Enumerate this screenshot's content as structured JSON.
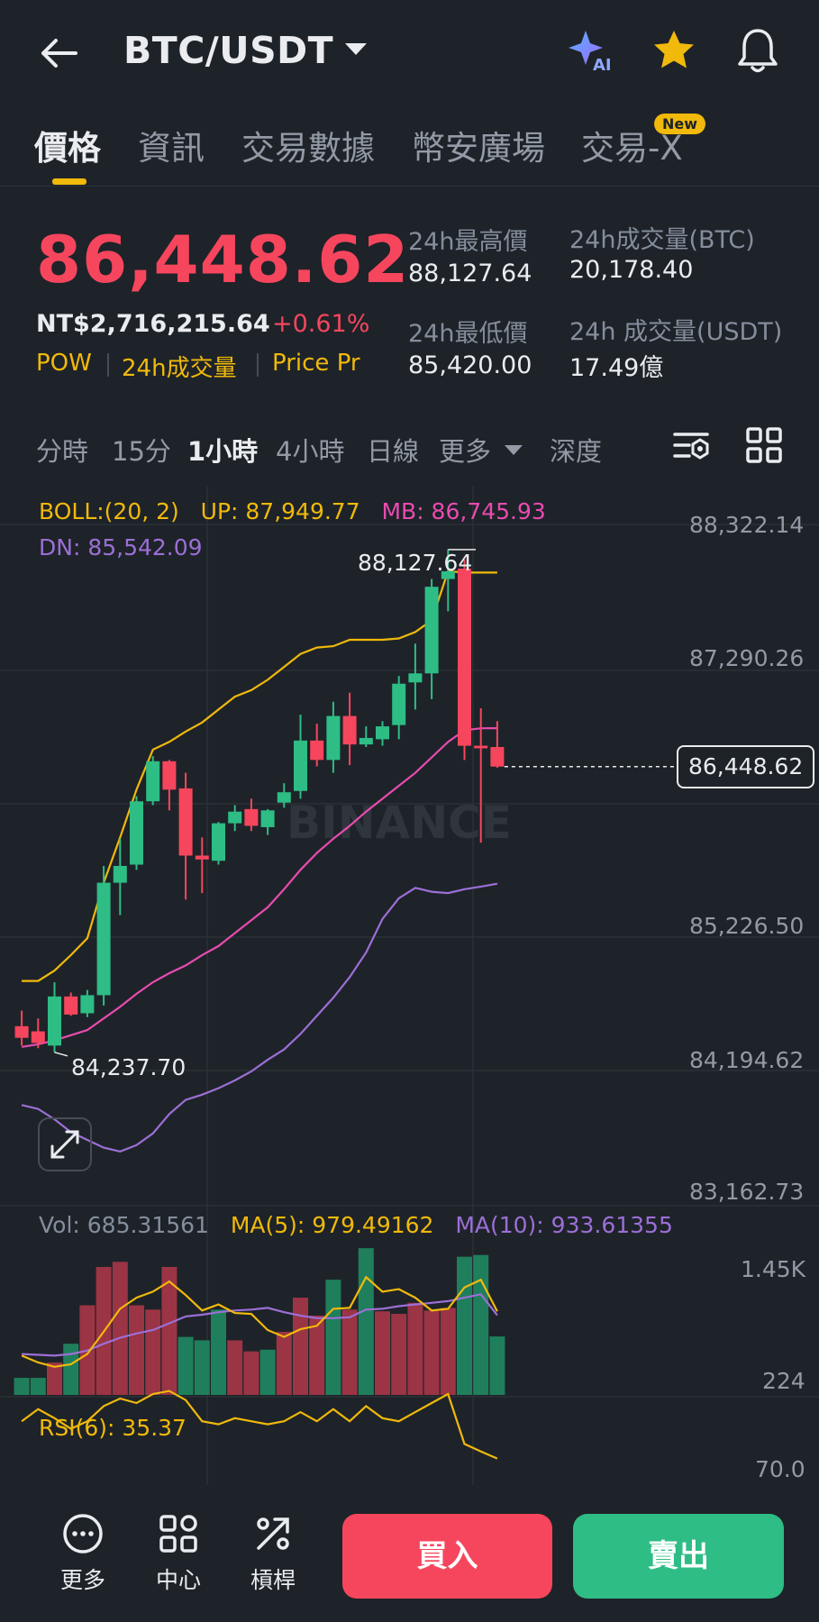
{
  "header": {
    "pair": "BTC/USDT"
  },
  "tabs": [
    {
      "label": "價格",
      "active": true
    },
    {
      "label": "資訊"
    },
    {
      "label": "交易數據"
    },
    {
      "label": "幣安廣場"
    },
    {
      "label": "交易-X",
      "badge": "New"
    }
  ],
  "ticker": {
    "last_price": "86,448.62",
    "fiat_price": "NT$2,716,215.64",
    "change_pct": "+0.61%",
    "tags": [
      "POW",
      "24h成交量",
      "Price Pr"
    ],
    "stats": [
      {
        "label": "24h最高價",
        "value": "88,127.64"
      },
      {
        "label": "24h成交量(BTC)",
        "value": "20,178.40"
      },
      {
        "label": "24h最低價",
        "value": "85,420.00"
      },
      {
        "label": "24h 成交量(USDT)",
        "value": "17.49億"
      }
    ]
  },
  "intervals": [
    "分時",
    "15分",
    "1小時",
    "4小時",
    "日線",
    "更多",
    "深度"
  ],
  "active_interval": "1小時",
  "indicators": {
    "boll_name": "BOLL:(20, 2)",
    "boll_up": "UP: 87,949.77",
    "boll_mb": "MB: 86,745.93",
    "boll_dn": "DN: 85,542.09",
    "vol": "Vol: 685.31561",
    "vol_ma5": "MA(5): 979.49162",
    "vol_ma10": "MA(10): 933.61355",
    "rsi": "RSI(6): 35.37"
  },
  "chart_axes": {
    "price_ticks": [
      "88,322.14",
      "87,290.26",
      "85,226.50",
      "84,194.62",
      "83,162.73"
    ],
    "current_price": "86,448.62",
    "high_marker": "88,127.64",
    "low_marker": "84,237.70",
    "vol_ticks": [
      "1.45K",
      "224"
    ],
    "rsi_ticks": [
      "70.0"
    ]
  },
  "watermark": "BINANCE",
  "colors": {
    "up": "#2ebd85",
    "down": "#f6465d",
    "accent": "#f0b90b",
    "mb": "#e84bb0",
    "dn": "#9c6fd6"
  },
  "chart_data": {
    "type": "candlestick",
    "candles": [
      {
        "o": 84440,
        "h": 84560,
        "l": 84290,
        "c": 84350
      },
      {
        "o": 84400,
        "h": 84500,
        "l": 84270,
        "c": 84310
      },
      {
        "o": 84290,
        "h": 84780,
        "l": 84237.7,
        "c": 84670
      },
      {
        "o": 84670,
        "h": 84700,
        "l": 84520,
        "c": 84530
      },
      {
        "o": 84540,
        "h": 84720,
        "l": 84510,
        "c": 84680
      },
      {
        "o": 84680,
        "h": 85680,
        "l": 84600,
        "c": 85550
      },
      {
        "o": 85550,
        "h": 85890,
        "l": 85300,
        "c": 85680
      },
      {
        "o": 85690,
        "h": 86220,
        "l": 85650,
        "c": 86180
      },
      {
        "o": 86180,
        "h": 86530,
        "l": 86150,
        "c": 86490
      },
      {
        "o": 86490,
        "h": 86500,
        "l": 86110,
        "c": 86270
      },
      {
        "o": 86280,
        "h": 86400,
        "l": 85420,
        "c": 85760
      },
      {
        "o": 85760,
        "h": 85900,
        "l": 85470,
        "c": 85730
      },
      {
        "o": 85720,
        "h": 86020,
        "l": 85690,
        "c": 86010
      },
      {
        "o": 86010,
        "h": 86150,
        "l": 85950,
        "c": 86100
      },
      {
        "o": 86120,
        "h": 86200,
        "l": 85950,
        "c": 85990
      },
      {
        "o": 85980,
        "h": 86120,
        "l": 85920,
        "c": 86110
      },
      {
        "o": 86170,
        "h": 86320,
        "l": 86130,
        "c": 86250
      },
      {
        "o": 86260,
        "h": 86850,
        "l": 86200,
        "c": 86650
      },
      {
        "o": 86650,
        "h": 86780,
        "l": 86450,
        "c": 86500
      },
      {
        "o": 86500,
        "h": 86950,
        "l": 86400,
        "c": 86840
      },
      {
        "o": 86840,
        "h": 87020,
        "l": 86460,
        "c": 86620
      },
      {
        "o": 86620,
        "h": 86760,
        "l": 86600,
        "c": 86670
      },
      {
        "o": 86660,
        "h": 86800,
        "l": 86610,
        "c": 86760
      },
      {
        "o": 86770,
        "h": 87150,
        "l": 86660,
        "c": 87090
      },
      {
        "o": 87100,
        "h": 87400,
        "l": 86890,
        "c": 87170
      },
      {
        "o": 87170,
        "h": 87900,
        "l": 86970,
        "c": 87840
      },
      {
        "o": 87900,
        "h": 88127.64,
        "l": 87650,
        "c": 87960
      },
      {
        "o": 87980,
        "h": 88050,
        "l": 86500,
        "c": 86610
      },
      {
        "o": 86610,
        "h": 86900,
        "l": 85860,
        "c": 86590
      },
      {
        "o": 86600,
        "h": 86800,
        "l": 86440,
        "c": 86448.62
      }
    ],
    "boll_up": [
      84790,
      84790,
      84870,
      84990,
      85120,
      85550,
      85900,
      86270,
      86580,
      86640,
      86720,
      86790,
      86890,
      86990,
      87040,
      87120,
      87220,
      87320,
      87370,
      87380,
      87430,
      87430,
      87430,
      87440,
      87490,
      87580,
      87960,
      87950,
      87950,
      87950
    ],
    "boll_mb": [
      84280,
      84300,
      84330,
      84370,
      84410,
      84500,
      84590,
      84690,
      84780,
      84850,
      84910,
      84990,
      85060,
      85160,
      85260,
      85360,
      85500,
      85650,
      85780,
      85890,
      85990,
      86100,
      86200,
      86300,
      86400,
      86520,
      86640,
      86730,
      86745,
      86745.93
    ],
    "boll_dn": [
      83830,
      83800,
      83720,
      83620,
      83560,
      83500,
      83470,
      83520,
      83610,
      83760,
      83870,
      83910,
      83960,
      84020,
      84090,
      84180,
      84260,
      84380,
      84520,
      84660,
      84820,
      85010,
      85270,
      85430,
      85510,
      85480,
      85470,
      85500,
      85520,
      85542.09
    ],
    "volume": [
      {
        "v": 200,
        "dir": "up"
      },
      {
        "v": 200,
        "dir": "up"
      },
      {
        "v": 380,
        "dir": "down"
      },
      {
        "v": 600,
        "dir": "up"
      },
      {
        "v": 1050,
        "dir": "down"
      },
      {
        "v": 1500,
        "dir": "down"
      },
      {
        "v": 1560,
        "dir": "down"
      },
      {
        "v": 1050,
        "dir": "down"
      },
      {
        "v": 1000,
        "dir": "down"
      },
      {
        "v": 1500,
        "dir": "down"
      },
      {
        "v": 680,
        "dir": "up"
      },
      {
        "v": 640,
        "dir": "up"
      },
      {
        "v": 1000,
        "dir": "up"
      },
      {
        "v": 640,
        "dir": "down"
      },
      {
        "v": 510,
        "dir": "down"
      },
      {
        "v": 530,
        "dir": "up"
      },
      {
        "v": 740,
        "dir": "down"
      },
      {
        "v": 1140,
        "dir": "down"
      },
      {
        "v": 930,
        "dir": "down"
      },
      {
        "v": 1350,
        "dir": "up"
      },
      {
        "v": 1000,
        "dir": "down"
      },
      {
        "v": 1720,
        "dir": "up"
      },
      {
        "v": 980,
        "dir": "down"
      },
      {
        "v": 950,
        "dir": "down"
      },
      {
        "v": 1080,
        "dir": "down"
      },
      {
        "v": 990,
        "dir": "down"
      },
      {
        "v": 1020,
        "dir": "down"
      },
      {
        "v": 1620,
        "dir": "up"
      },
      {
        "v": 1640,
        "dir": "up"
      },
      {
        "v": 685.31561,
        "dir": "up"
      }
    ],
    "vol_ma5": [
      460,
      380,
      330,
      360,
      480,
      740,
      1010,
      1140,
      1210,
      1330,
      1170,
      990,
      1060,
      960,
      950,
      760,
      680,
      770,
      810,
      1010,
      1020,
      1380,
      1210,
      1240,
      1140,
      990,
      1010,
      1260,
      1350,
      979.49162
    ],
    "vol_ma10": [
      480,
      470,
      460,
      480,
      520,
      600,
      670,
      720,
      760,
      840,
      920,
      940,
      970,
      990,
      1000,
      1020,
      970,
      930,
      900,
      900,
      910,
      1000,
      1010,
      1040,
      1060,
      1080,
      1100,
      1140,
      1180,
      933.61355
    ],
    "rsi6": [
      60,
      68,
      62,
      55,
      60,
      70,
      75,
      72,
      78,
      80,
      74,
      60,
      58,
      62,
      60,
      58,
      60,
      66,
      60,
      68,
      60,
      70,
      62,
      60,
      66,
      72,
      78,
      45,
      40,
      35.37
    ],
    "price_axis_range": [
      83162.73,
      88322.14
    ],
    "vol_axis_range": [
      224,
      1450
    ]
  },
  "bottom_nav": [
    {
      "label": "更多",
      "icon": "more-icon"
    },
    {
      "label": "中心",
      "icon": "grid-icon"
    },
    {
      "label": "槓桿",
      "icon": "leverage-icon"
    }
  ],
  "actions": {
    "buy": "買入",
    "sell": "賣出"
  }
}
